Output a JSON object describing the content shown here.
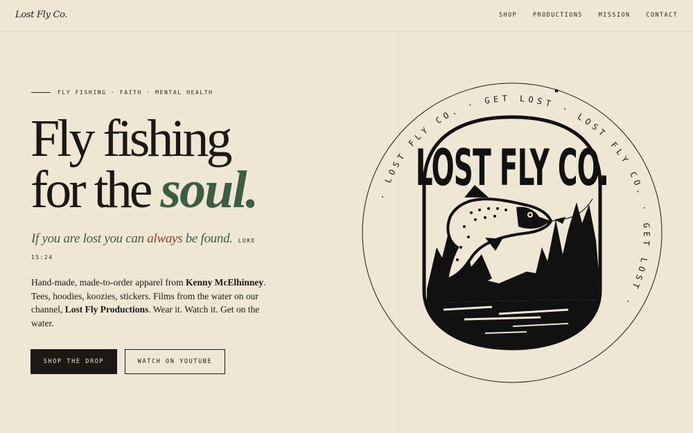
{
  "header": {
    "brand": "Lost Fly Co.",
    "nav": [
      "SHOP",
      "PRODUCTIONS",
      "MISSION",
      "CONTACT"
    ]
  },
  "hero": {
    "eyebrow": "FLY FISHING · FAITH · MENTAL HEALTH",
    "headline_line1": "Fly fishing",
    "headline_line2_plain": "for the ",
    "headline_line2_em": "soul.",
    "quote_part1": "If you are lost you can ",
    "quote_red": "always",
    "quote_part2": " be found.",
    "quote_ref_a": "LUKE",
    "quote_ref_b": "15:24",
    "body_1": "Hand-made, made-to-order apparel from ",
    "body_name": "Kenny McElhinney",
    "body_2": ". Tees, hoodies, koozies, stickers. Films from the water on our channel, ",
    "body_channel": "Lost Fly Productions",
    "body_3": ". Wear it. Watch it. Get on the water.",
    "cta_primary": "SHOP THE DROP",
    "cta_secondary": "WATCH ON YOUTUBE"
  },
  "logo": {
    "badge_text": "LOST FLY CO.",
    "ring_text": "· LOST FLY CO. · GET LOST · LOST FLY CO. · GET LOST ·",
    "icon": "leaping-trout-emblem"
  },
  "colors": {
    "background": "#efe7d4",
    "ink": "#1c1814",
    "green": "#3b5e43",
    "red": "#9a3b24"
  }
}
